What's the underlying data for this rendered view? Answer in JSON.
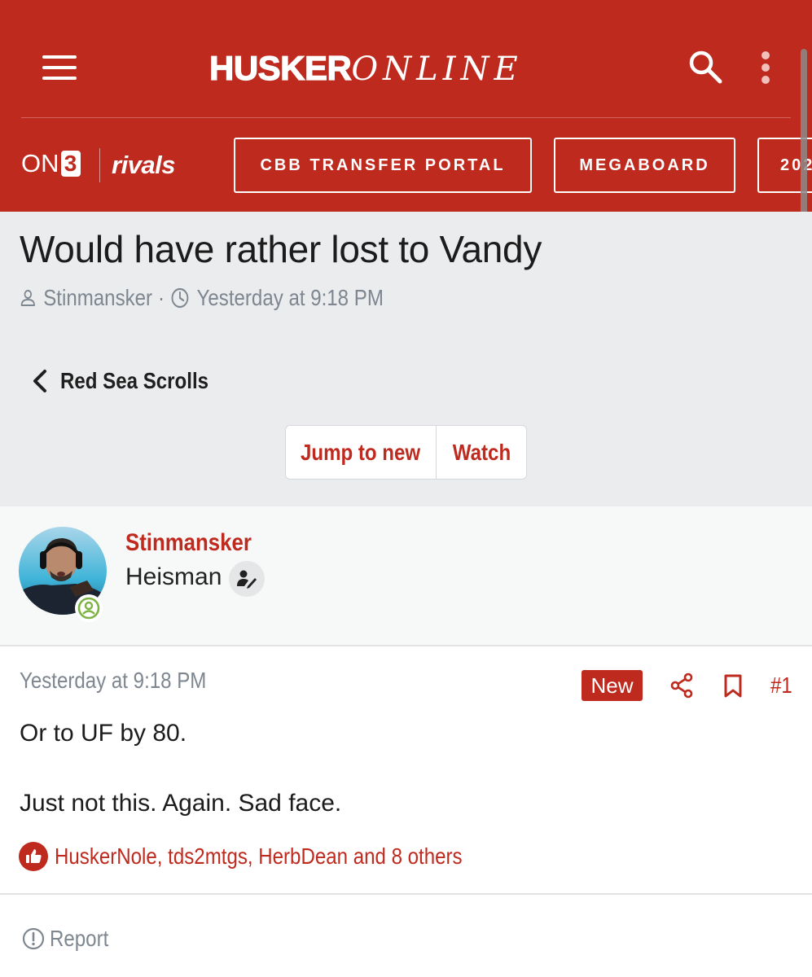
{
  "header": {
    "logo_bold": "HUSKER",
    "logo_light": "ONLINE",
    "brand_on": "ON",
    "brand_three": "3",
    "brand_rivals": "rivals",
    "nav": [
      {
        "label": "CBB TRANSFER PORTAL"
      },
      {
        "label": "MEGABOARD"
      },
      {
        "label": "202"
      }
    ],
    "background_color": "#bf2a1f"
  },
  "thread": {
    "title": "Would have rather lost to Vandy",
    "author": "Stinmansker",
    "separator": "·",
    "time": "Yesterday at 9:18 PM",
    "forum_back": "Red Sea Scrolls",
    "jump_label": "Jump to new",
    "watch_label": "Watch"
  },
  "post": {
    "username": "Stinmansker",
    "user_title": "Heisman",
    "date": "Yesterday at 9:18 PM",
    "new_badge": "New",
    "number": "#1",
    "body": [
      "Or to UF by 80.",
      "Just not this. Again. Sad face."
    ],
    "reactions": "HuskerNole, tds2mtgs, HerbDean and 8 others",
    "report_label": "Report"
  },
  "icons": [
    "menu-icon",
    "search-icon",
    "more-vertical-icon",
    "user-icon",
    "clock-icon",
    "chevron-left-icon",
    "online-status-icon",
    "user-edit-icon",
    "share-icon",
    "bookmark-icon",
    "thumbs-up-icon",
    "report-icon"
  ],
  "colors": {
    "accent": "#bf2a1f",
    "online": "#7cb342",
    "muted_text": "#7e8690"
  }
}
